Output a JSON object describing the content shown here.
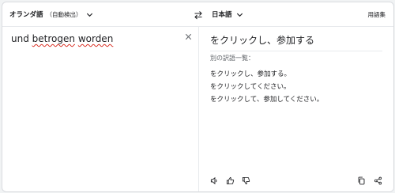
{
  "header": {
    "source_lang": "オランダ語",
    "source_mode": "（自動検出）",
    "target_lang": "日本語",
    "glossary_label": "用語集"
  },
  "source": {
    "text_parts": [
      "und ",
      "betrogen",
      " ",
      "worden"
    ]
  },
  "target": {
    "translation": "をクリックし、参加する",
    "alternatives_title": "別の訳語一覧：",
    "alternatives": [
      "をクリックし、参加する。",
      "をクリックしてください。",
      "をクリックして、参加してください。"
    ]
  }
}
